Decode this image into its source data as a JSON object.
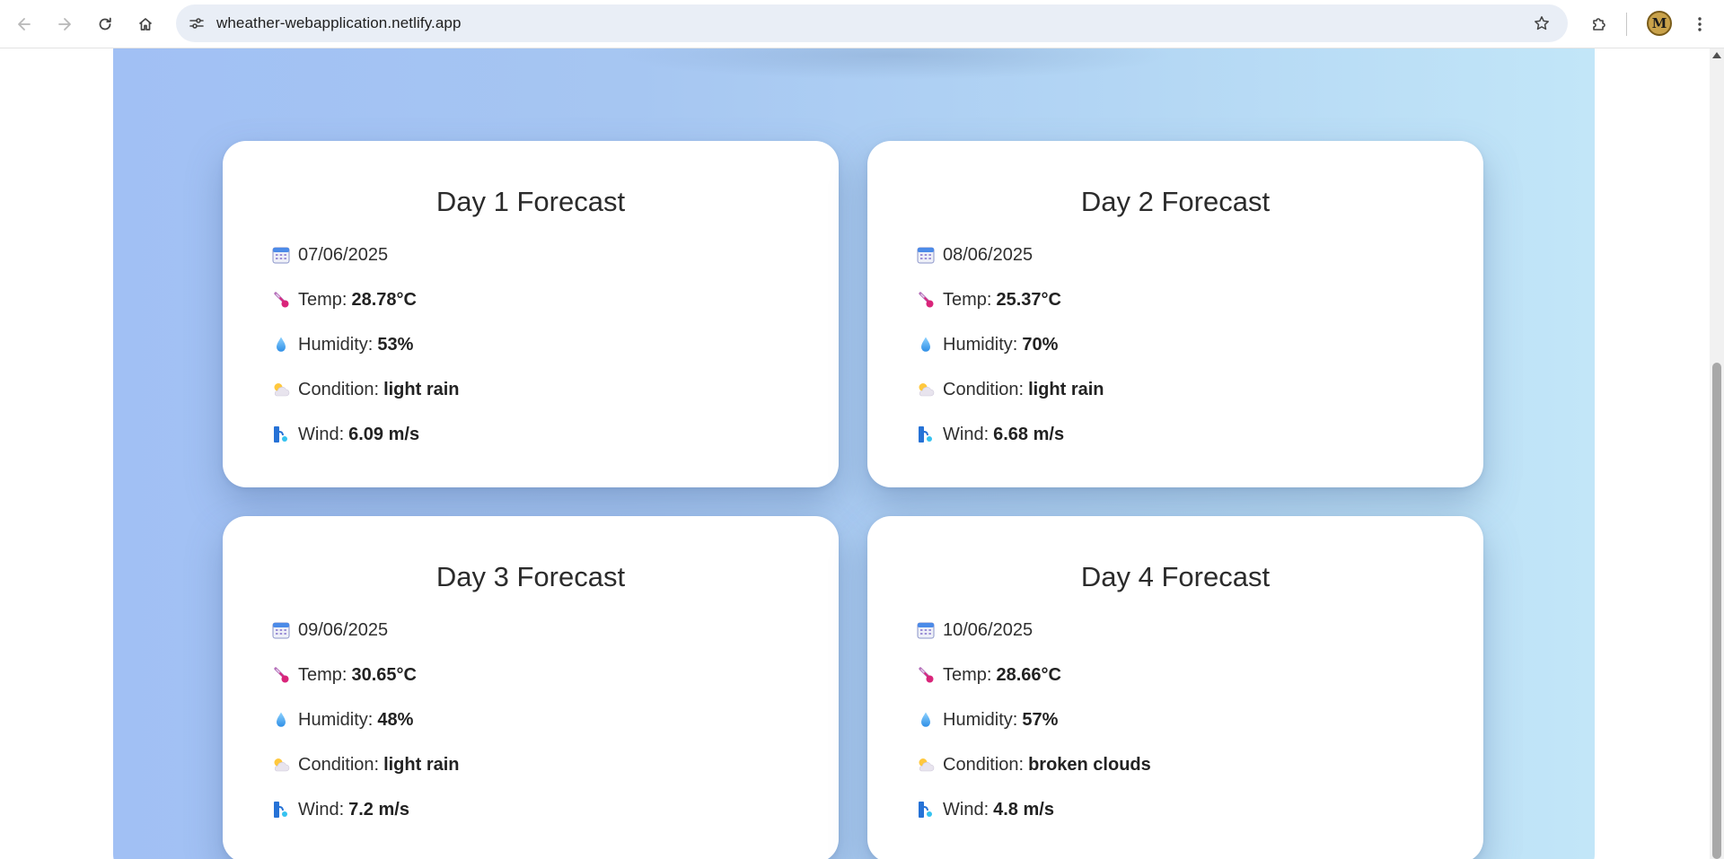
{
  "browser": {
    "url": "wheather-webapplication.netlify.app",
    "profile_initial": "M"
  },
  "forecast": {
    "label_temp": "Temp:",
    "label_humidity": "Humidity:",
    "label_condition": "Condition:",
    "label_wind": "Wind:",
    "days": [
      {
        "title": "Day 1 Forecast",
        "date": "07/06/2025",
        "temp": "28.78°C",
        "humidity": "53%",
        "condition": "light rain",
        "wind": "6.09 m/s"
      },
      {
        "title": "Day 2 Forecast",
        "date": "08/06/2025",
        "temp": "25.37°C",
        "humidity": "70%",
        "condition": "light rain",
        "wind": "6.68 m/s"
      },
      {
        "title": "Day 3 Forecast",
        "date": "09/06/2025",
        "temp": "30.65°C",
        "humidity": "48%",
        "condition": "light rain",
        "wind": "7.2 m/s"
      },
      {
        "title": "Day 4 Forecast",
        "date": "10/06/2025",
        "temp": "28.66°C",
        "humidity": "57%",
        "condition": "broken clouds",
        "wind": "4.8 m/s"
      }
    ]
  },
  "icons": {
    "date": "calendar-icon",
    "temp": "thermometer-icon",
    "humidity": "droplet-icon",
    "condition": "sun-behind-cloud-icon",
    "wind": "wind-icon"
  },
  "colors": {
    "panel_gradient_start": "#a1c0f4",
    "panel_gradient_end": "#c2e6f8",
    "card_background": "#ffffff"
  }
}
